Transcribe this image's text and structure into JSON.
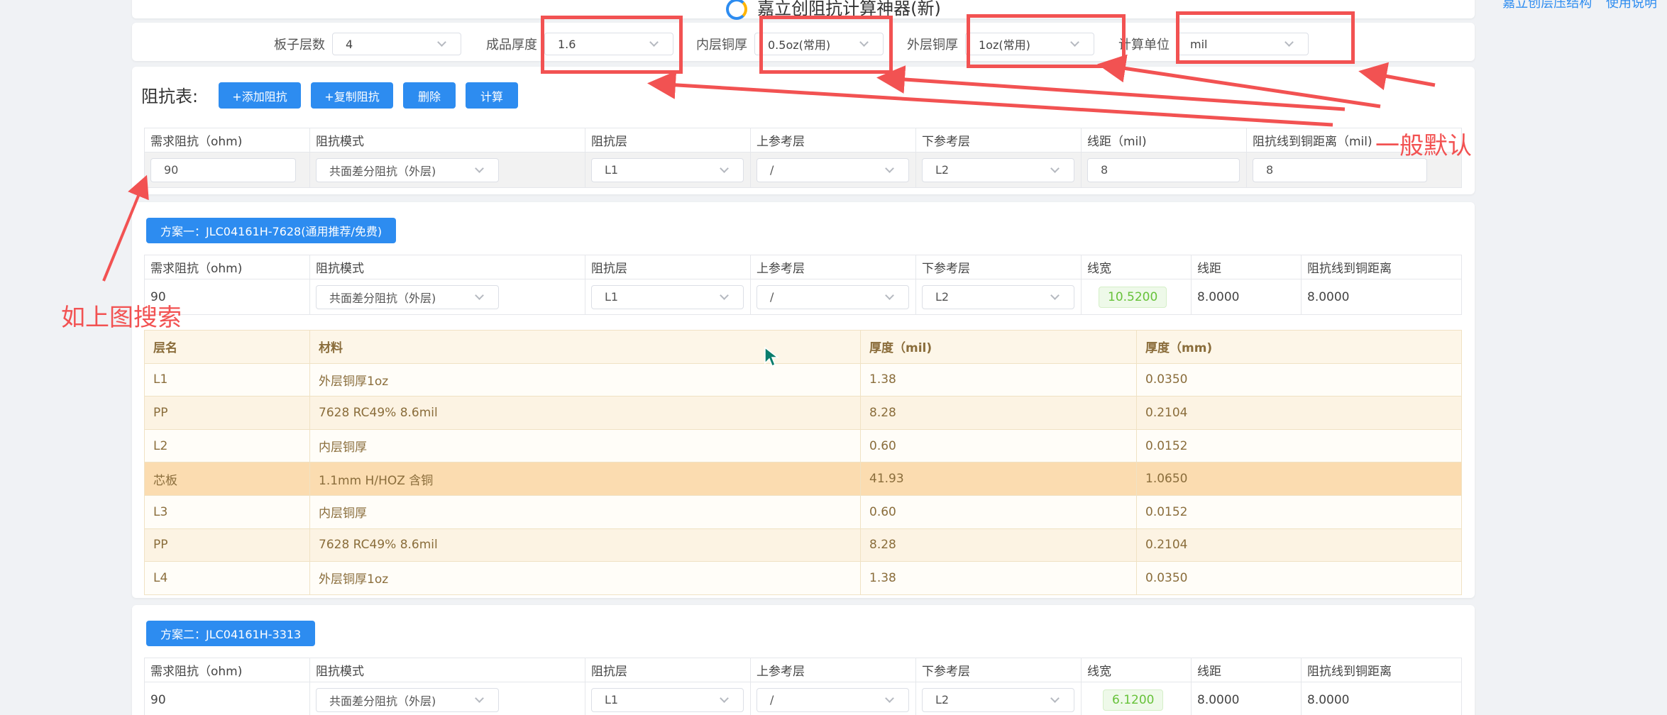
{
  "header": {
    "title": "嘉立创阻抗计算神器(新)",
    "link_structure": "嘉立创层压结构",
    "link_help": "使用说明"
  },
  "settings": {
    "layers_label": "板子层数",
    "layers_value": "4",
    "thickness_label": "成品厚度",
    "thickness_value": "1.6",
    "inner_copper_label": "内层铜厚",
    "inner_copper_value": "0.5oz(常用)",
    "outer_copper_label": "外层铜厚",
    "outer_copper_value": "1oz(常用)",
    "unit_label": "计算单位",
    "unit_value": "mil"
  },
  "impedance": {
    "label": "阻抗表:",
    "buttons": {
      "add": "+添加阻抗",
      "copy": "+复制阻抗",
      "delete": "删除",
      "calc": "计算"
    },
    "columns": [
      "需求阻抗（ohm)",
      "阻抗模式",
      "阻抗层",
      "上参考层",
      "下参考层",
      "线距（mil)",
      "阻抗线到铜距离（mil)"
    ],
    "row": {
      "impedance": "90",
      "mode": "共面差分阻抗（外层)",
      "layer": "L1",
      "upper_ref": "/",
      "lower_ref": "L2",
      "spacing": "8",
      "to_copper": "8"
    }
  },
  "plan1": {
    "title": "方案一：JLC04161H-7628(通用推荐/免费)",
    "columns": [
      "需求阻抗（ohm)",
      "阻抗模式",
      "阻抗层",
      "上参考层",
      "下参考层",
      "线宽",
      "线距",
      "阻抗线到铜距离"
    ],
    "row": {
      "impedance": "90",
      "mode": "共面差分阻抗（外层)",
      "layer": "L1",
      "upper_ref": "/",
      "lower_ref": "L2",
      "width": "10.5200",
      "spacing": "8.0000",
      "to_copper": "8.0000"
    },
    "stack_columns": [
      "层名",
      "材料",
      "厚度（mil)",
      "厚度（mm)"
    ],
    "stack": [
      {
        "name": "L1",
        "material": "外层铜厚1oz",
        "mil": "1.38",
        "mm": "0.0350"
      },
      {
        "name": "PP",
        "material": "7628 RC49% 8.6mil",
        "mil": "8.28",
        "mm": "0.2104"
      },
      {
        "name": "L2",
        "material": "内层铜厚",
        "mil": "0.60",
        "mm": "0.0152"
      },
      {
        "name": "芯板",
        "material": "1.1mm H/HOZ 含铜",
        "mil": "41.93",
        "mm": "1.0650"
      },
      {
        "name": "L3",
        "material": "内层铜厚",
        "mil": "0.60",
        "mm": "0.0152"
      },
      {
        "name": "PP",
        "material": "7628 RC49% 8.6mil",
        "mil": "8.28",
        "mm": "0.2104"
      },
      {
        "name": "L4",
        "material": "外层铜厚1oz",
        "mil": "1.38",
        "mm": "0.0350"
      }
    ]
  },
  "plan2": {
    "title": "方案二：JLC04161H-3313",
    "columns": [
      "需求阻抗（ohm)",
      "阻抗模式",
      "阻抗层",
      "上参考层",
      "下参考层",
      "线宽",
      "线距",
      "阻抗线到铜距离"
    ],
    "row": {
      "impedance": "90",
      "mode": "共面差分阻抗（外层)",
      "layer": "L1",
      "upper_ref": "/",
      "lower_ref": "L2",
      "width": "6.1200",
      "spacing": "8.0000",
      "to_copper": "8.0000"
    }
  },
  "annotations": {
    "default_note": "一般默认",
    "search_note": "如上图搜索",
    "color": "#f25252"
  }
}
